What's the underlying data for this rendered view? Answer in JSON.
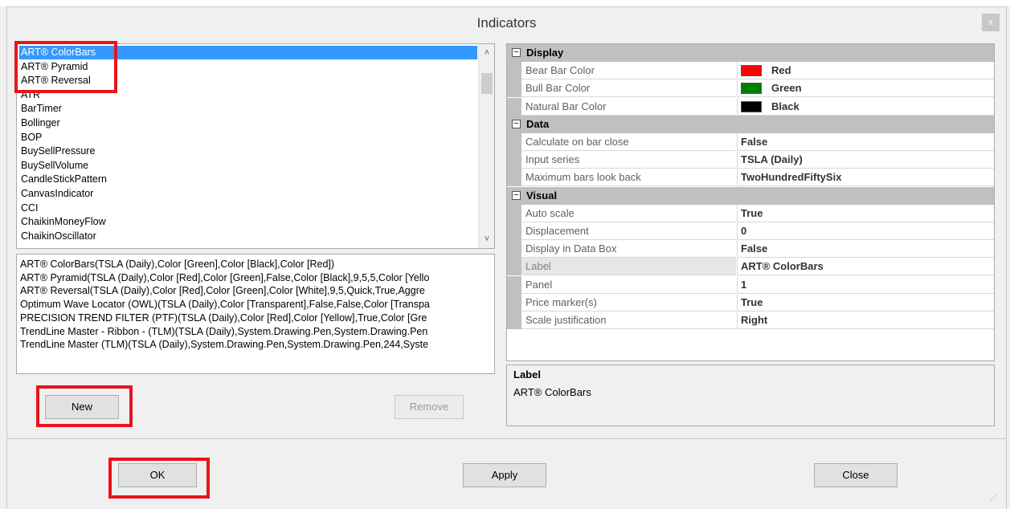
{
  "window": {
    "title": "Indicators",
    "close_glyph": "x"
  },
  "indicator_list": {
    "items": [
      "ART® ColorBars",
      "ART® Pyramid",
      "ART® Reversal",
      "ATR",
      "BarTimer",
      "Bollinger",
      "BOP",
      "BuySellPressure",
      "BuySellVolume",
      "CandleStickPattern",
      "CanvasIndicator",
      "CCI",
      "ChaikinMoneyFlow",
      "ChaikinOscillator"
    ],
    "selected_index": 0,
    "scroll_up_glyph": "˄",
    "scroll_down_glyph": "˅"
  },
  "configured_indicators": [
    "ART® ColorBars(TSLA (Daily),Color [Green],Color [Black],Color [Red])",
    "ART® Pyramid(TSLA (Daily),Color [Red],Color [Green],False,Color [Black],9,5,5,Color [Yello",
    "ART® Reversal(TSLA (Daily),Color [Red],Color [Green],Color [White],9,5,Quick,True,Aggre",
    "Optimum Wave Locator (OWL)(TSLA (Daily),Color [Transparent],False,False,Color [Transpa",
    "PRECISION TREND FILTER (PTF)(TSLA (Daily),Color [Red],Color [Yellow],True,Color [Gre",
    "TrendLine Master - Ribbon - (TLM)(TSLA (Daily),System.Drawing.Pen,System.Drawing.Pen",
    "TrendLine Master (TLM)(TSLA (Daily),System.Drawing.Pen,System.Drawing.Pen,244,Syste"
  ],
  "buttons": {
    "new": "New",
    "remove": "Remove",
    "ok": "OK",
    "apply": "Apply",
    "close": "Close"
  },
  "property_grid": {
    "expander_glyph": "⊟",
    "rows": [
      {
        "kind": "category",
        "name": "Display"
      },
      {
        "kind": "prop",
        "name": "Bear Bar Color",
        "value": "Red",
        "swatch": "#ff0000"
      },
      {
        "kind": "prop",
        "name": "Bull Bar Color",
        "value": "Green",
        "swatch": "#008000"
      },
      {
        "kind": "prop",
        "name": "Natural Bar Color",
        "value": "Black",
        "swatch": "#000000"
      },
      {
        "kind": "category",
        "name": "Data"
      },
      {
        "kind": "prop",
        "name": "Calculate on bar close",
        "value": "False"
      },
      {
        "kind": "prop",
        "name": "Input series",
        "value": "TSLA (Daily)"
      },
      {
        "kind": "prop",
        "name": "Maximum bars look back",
        "value": "TwoHundredFiftySix"
      },
      {
        "kind": "category",
        "name": "Visual"
      },
      {
        "kind": "prop",
        "name": "Auto scale",
        "value": "True"
      },
      {
        "kind": "prop",
        "name": "Displacement",
        "value": "0"
      },
      {
        "kind": "prop",
        "name": "Display in Data Box",
        "value": "False"
      },
      {
        "kind": "prop",
        "name": "Label",
        "value": "ART® ColorBars",
        "highlight": true
      },
      {
        "kind": "prop",
        "name": "Panel",
        "value": "1"
      },
      {
        "kind": "prop",
        "name": "Price marker(s)",
        "value": "True"
      },
      {
        "kind": "prop",
        "name": "Scale justification",
        "value": "Right"
      }
    ]
  },
  "help": {
    "title": "Label",
    "text": "ART® ColorBars"
  },
  "colors": {
    "selection": "#3399ff",
    "annotation": "#e8141c",
    "category_bg": "#c0c0c0"
  }
}
